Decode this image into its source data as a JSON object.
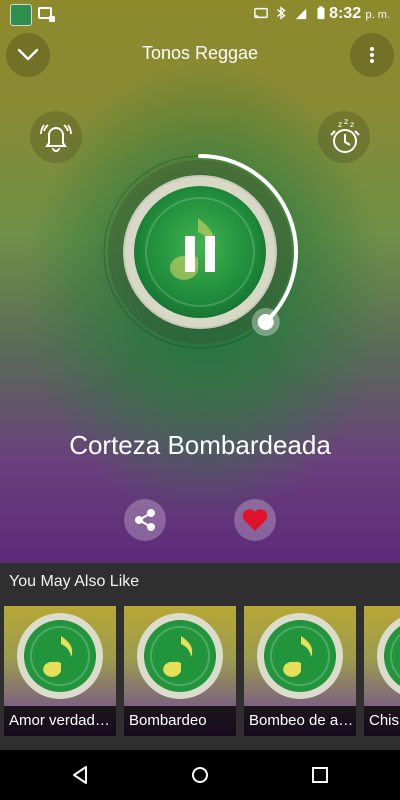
{
  "status": {
    "time": "8:32",
    "ampm": "p. m."
  },
  "header": {
    "title": "Tonos Reggae"
  },
  "player": {
    "song_title": "Corteza Bombardeada",
    "progress": 0.38
  },
  "recommend": {
    "heading": "You May Also Like",
    "items": [
      {
        "label": "Amor verdadero"
      },
      {
        "label": "Bombardeo"
      },
      {
        "label": "Bombeo de agua"
      },
      {
        "label": "Chispa"
      }
    ]
  },
  "colors": {
    "accent_green": "#27a33a",
    "heart_red": "#e0122a",
    "section_bg": "#2f2f2f"
  }
}
